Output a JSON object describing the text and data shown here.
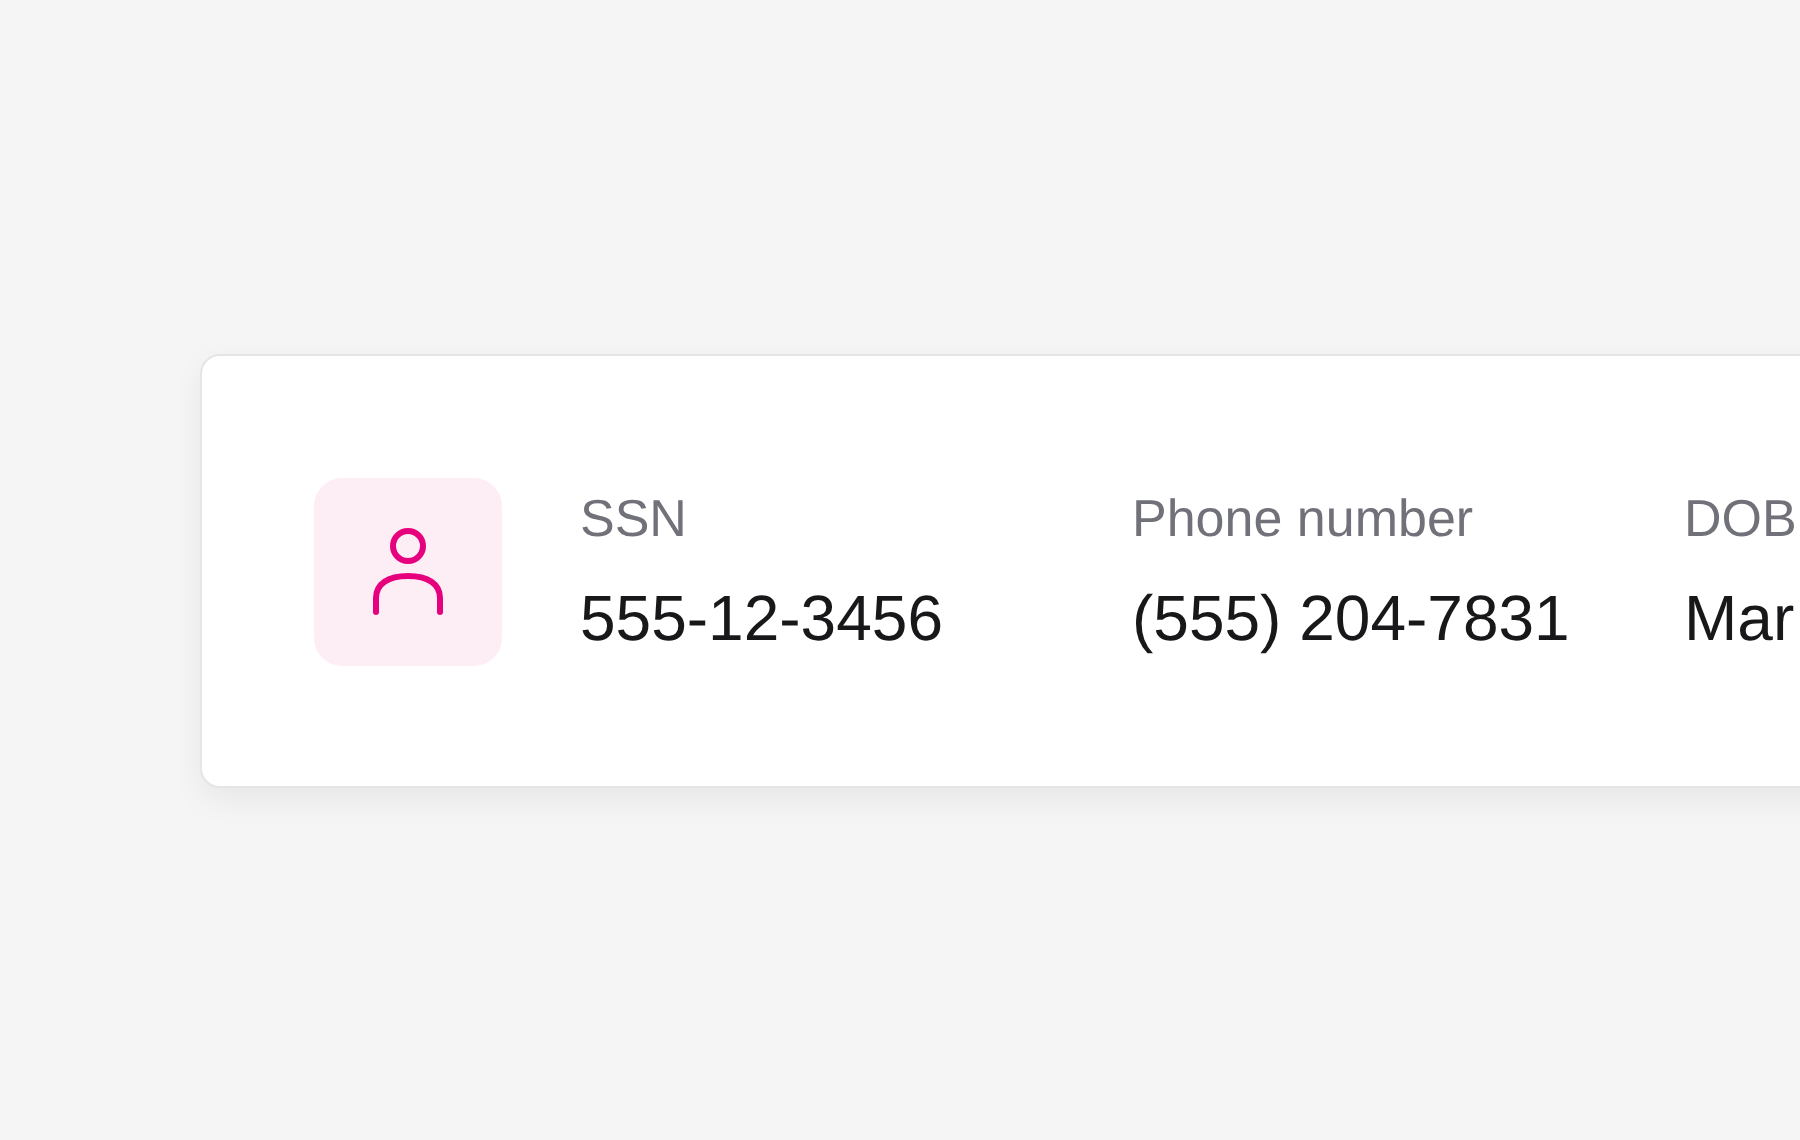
{
  "fields": [
    {
      "label": "SSN",
      "value": "555-12-3456"
    },
    {
      "label": "Phone number",
      "value": "(555) 204-7831"
    },
    {
      "label": "DOB",
      "value": "Mar"
    }
  ]
}
